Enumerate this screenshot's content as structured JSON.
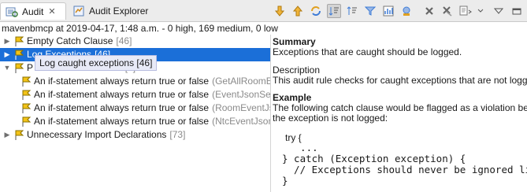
{
  "tabs": [
    {
      "label": "Audit",
      "active": true
    },
    {
      "label": "Audit Explorer",
      "active": false
    }
  ],
  "toolbar": {
    "icons": [
      "arrow-down-icon",
      "arrow-up-icon",
      "refresh-icon",
      "sort-pressed-icon",
      "sort-icon",
      "filter-icon",
      "chart-icon",
      "plugin-icon",
      "delete-icon",
      "delete-all-icon",
      "export-icon",
      "view-menu-icon",
      "minimize-icon"
    ]
  },
  "summary_line": "mavenbmcp at 2019-04-17, 1:48 a.m. - 0 high, 169 medium, 0 low",
  "tree": {
    "rows": [
      {
        "label": "Empty Catch Clause",
        "count": "[46]"
      },
      {
        "label": "Log Exceptions",
        "count": "[46]"
      },
      {
        "label": "P",
        "count": "ue [4]"
      },
      {
        "label": "An if-statement always return true or false",
        "loc": "(GetAllRoomEvent."
      },
      {
        "label": "An if-statement always return true or false",
        "loc": "(EventJsonServlet."
      },
      {
        "label": "An if-statement always return true or false",
        "loc": "(RoomEventJsonSe"
      },
      {
        "label": "An if-statement always return true or false",
        "loc": "(NtcEventJsonServ"
      },
      {
        "label": "Unnecessary Import Declarations",
        "count": "[73]"
      }
    ],
    "tooltip": "Log caught exceptions [46]"
  },
  "details": {
    "summary_heading": "Summary",
    "summary_text": "Exceptions that are caught should be logged.",
    "description_heading": "Description",
    "description_text": "This audit rule checks for caught exceptions that are not logged.",
    "example_heading": "Example",
    "example_text_1": "The following catch clause would be flagged as a violation because",
    "example_text_2": "the exception is not logged:",
    "code": [
      "try {",
      "  ...",
      "} catch (Exception exception) {",
      "  // Exceptions should never be ignored like this",
      "}"
    ]
  },
  "colors": {
    "selection": "#1b6fd8",
    "flag": "#e8b400",
    "arrow_blue": "#3e7bd6"
  }
}
